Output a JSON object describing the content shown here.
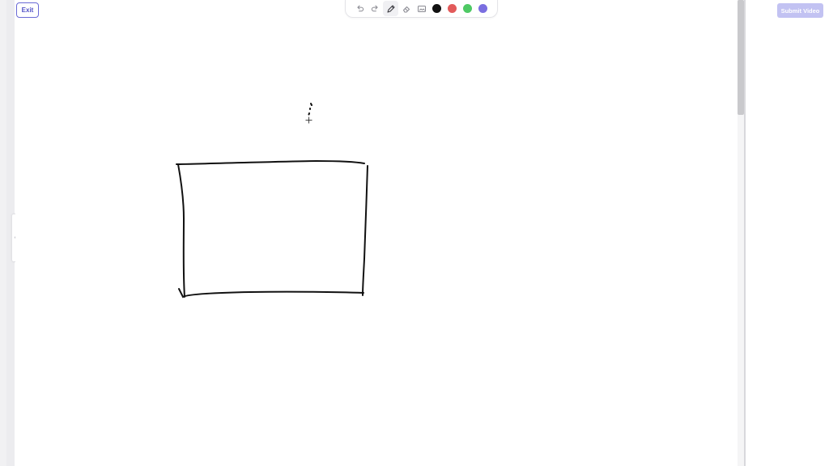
{
  "header": {
    "exit_label": "Exit",
    "submit_label": "Submit Video"
  },
  "toolbar": {
    "tools": [
      {
        "name": "undo-icon"
      },
      {
        "name": "redo-icon"
      },
      {
        "name": "pen-icon",
        "active": true
      },
      {
        "name": "eraser-icon"
      },
      {
        "name": "image-icon"
      }
    ],
    "colors": [
      "#111111",
      "#e25a5a",
      "#4ec964",
      "#7a6ee0"
    ]
  },
  "sidebar": {
    "collapse_icon": "chevron-left-icon"
  }
}
